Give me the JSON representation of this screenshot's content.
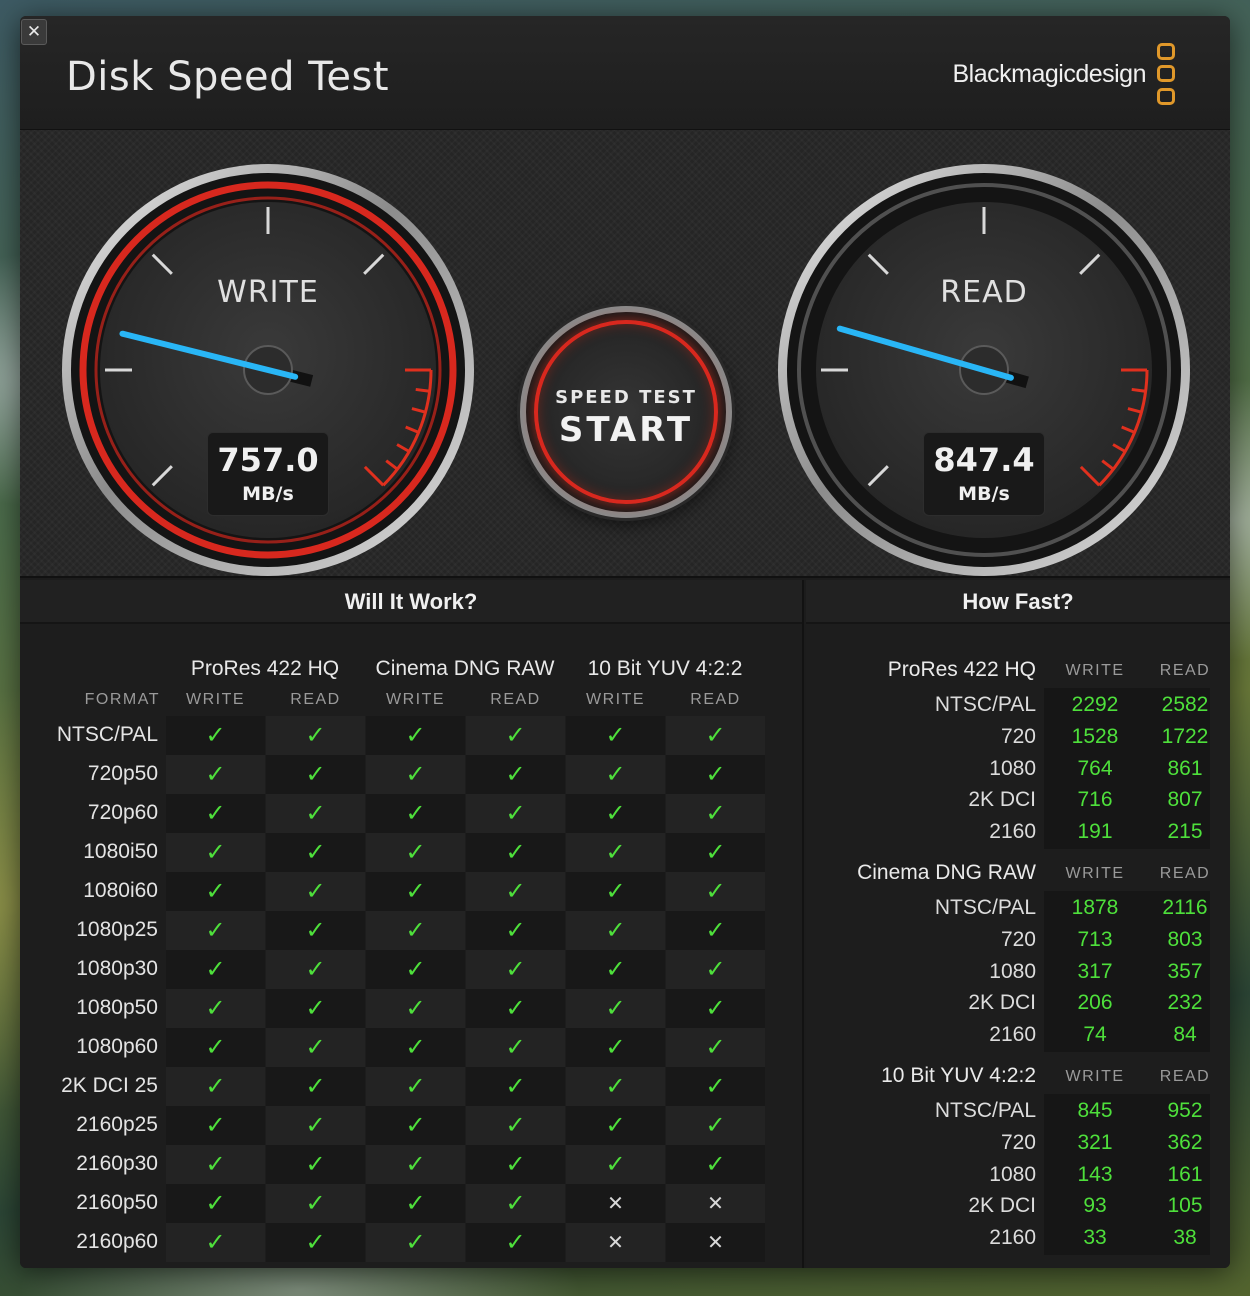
{
  "window": {
    "title": "Disk Speed Test",
    "brand": "Blackmagicdesign",
    "close_glyph": "✕"
  },
  "gauges": {
    "write": {
      "label": "WRITE",
      "value": "757.0",
      "unit": "MB/s",
      "accent": "#e0301e",
      "needle_color": "#29b6f6"
    },
    "read": {
      "label": "READ",
      "value": "847.4",
      "unit": "MB/s",
      "accent": "#e0301e",
      "needle_color": "#29b6f6"
    }
  },
  "start_button": {
    "line1": "SPEED TEST",
    "line2": "START"
  },
  "settings_icon": "⚙",
  "will_it_work": {
    "title": "Will It Work?",
    "format_header": "FORMAT",
    "codecs": [
      "ProRes 422 HQ",
      "Cinema DNG RAW",
      "10 Bit YUV 4:2:2"
    ],
    "col_labels": [
      "WRITE",
      "READ",
      "WRITE",
      "READ",
      "WRITE",
      "READ"
    ],
    "rows": [
      {
        "format": "NTSC/PAL",
        "cells": [
          "✓",
          "✓",
          "✓",
          "✓",
          "✓",
          "✓"
        ]
      },
      {
        "format": "720p50",
        "cells": [
          "✓",
          "✓",
          "✓",
          "✓",
          "✓",
          "✓"
        ]
      },
      {
        "format": "720p60",
        "cells": [
          "✓",
          "✓",
          "✓",
          "✓",
          "✓",
          "✓"
        ]
      },
      {
        "format": "1080i50",
        "cells": [
          "✓",
          "✓",
          "✓",
          "✓",
          "✓",
          "✓"
        ]
      },
      {
        "format": "1080i60",
        "cells": [
          "✓",
          "✓",
          "✓",
          "✓",
          "✓",
          "✓"
        ]
      },
      {
        "format": "1080p25",
        "cells": [
          "✓",
          "✓",
          "✓",
          "✓",
          "✓",
          "✓"
        ]
      },
      {
        "format": "1080p30",
        "cells": [
          "✓",
          "✓",
          "✓",
          "✓",
          "✓",
          "✓"
        ]
      },
      {
        "format": "1080p50",
        "cells": [
          "✓",
          "✓",
          "✓",
          "✓",
          "✓",
          "✓"
        ]
      },
      {
        "format": "1080p60",
        "cells": [
          "✓",
          "✓",
          "✓",
          "✓",
          "✓",
          "✓"
        ]
      },
      {
        "format": "2K DCI 25",
        "cells": [
          "✓",
          "✓",
          "✓",
          "✓",
          "✓",
          "✓"
        ]
      },
      {
        "format": "2160p25",
        "cells": [
          "✓",
          "✓",
          "✓",
          "✓",
          "✓",
          "✓"
        ]
      },
      {
        "format": "2160p30",
        "cells": [
          "✓",
          "✓",
          "✓",
          "✓",
          "✓",
          "✓"
        ]
      },
      {
        "format": "2160p50",
        "cells": [
          "✓",
          "✓",
          "✓",
          "✓",
          "✕",
          "✕"
        ]
      },
      {
        "format": "2160p60",
        "cells": [
          "✓",
          "✓",
          "✓",
          "✓",
          "✕",
          "✕"
        ]
      }
    ]
  },
  "how_fast": {
    "title": "How Fast?",
    "col_write": "WRITE",
    "col_read": "READ",
    "groups": [
      {
        "codec": "ProRes 422 HQ",
        "rows": [
          {
            "format": "NTSC/PAL",
            "write": "2292",
            "read": "2582"
          },
          {
            "format": "720",
            "write": "1528",
            "read": "1722"
          },
          {
            "format": "1080",
            "write": "764",
            "read": "861"
          },
          {
            "format": "2K DCI",
            "write": "716",
            "read": "807"
          },
          {
            "format": "2160",
            "write": "191",
            "read": "215"
          }
        ]
      },
      {
        "codec": "Cinema DNG RAW",
        "rows": [
          {
            "format": "NTSC/PAL",
            "write": "1878",
            "read": "2116"
          },
          {
            "format": "720",
            "write": "713",
            "read": "803"
          },
          {
            "format": "1080",
            "write": "317",
            "read": "357"
          },
          {
            "format": "2K DCI",
            "write": "206",
            "read": "232"
          },
          {
            "format": "2160",
            "write": "74",
            "read": "84"
          }
        ]
      },
      {
        "codec": "10 Bit YUV 4:2:2",
        "rows": [
          {
            "format": "NTSC/PAL",
            "write": "845",
            "read": "952"
          },
          {
            "format": "720",
            "write": "321",
            "read": "362"
          },
          {
            "format": "1080",
            "write": "143",
            "read": "161"
          },
          {
            "format": "2K DCI",
            "write": "93",
            "read": "105"
          },
          {
            "format": "2160",
            "write": "33",
            "read": "38"
          }
        ]
      }
    ]
  }
}
